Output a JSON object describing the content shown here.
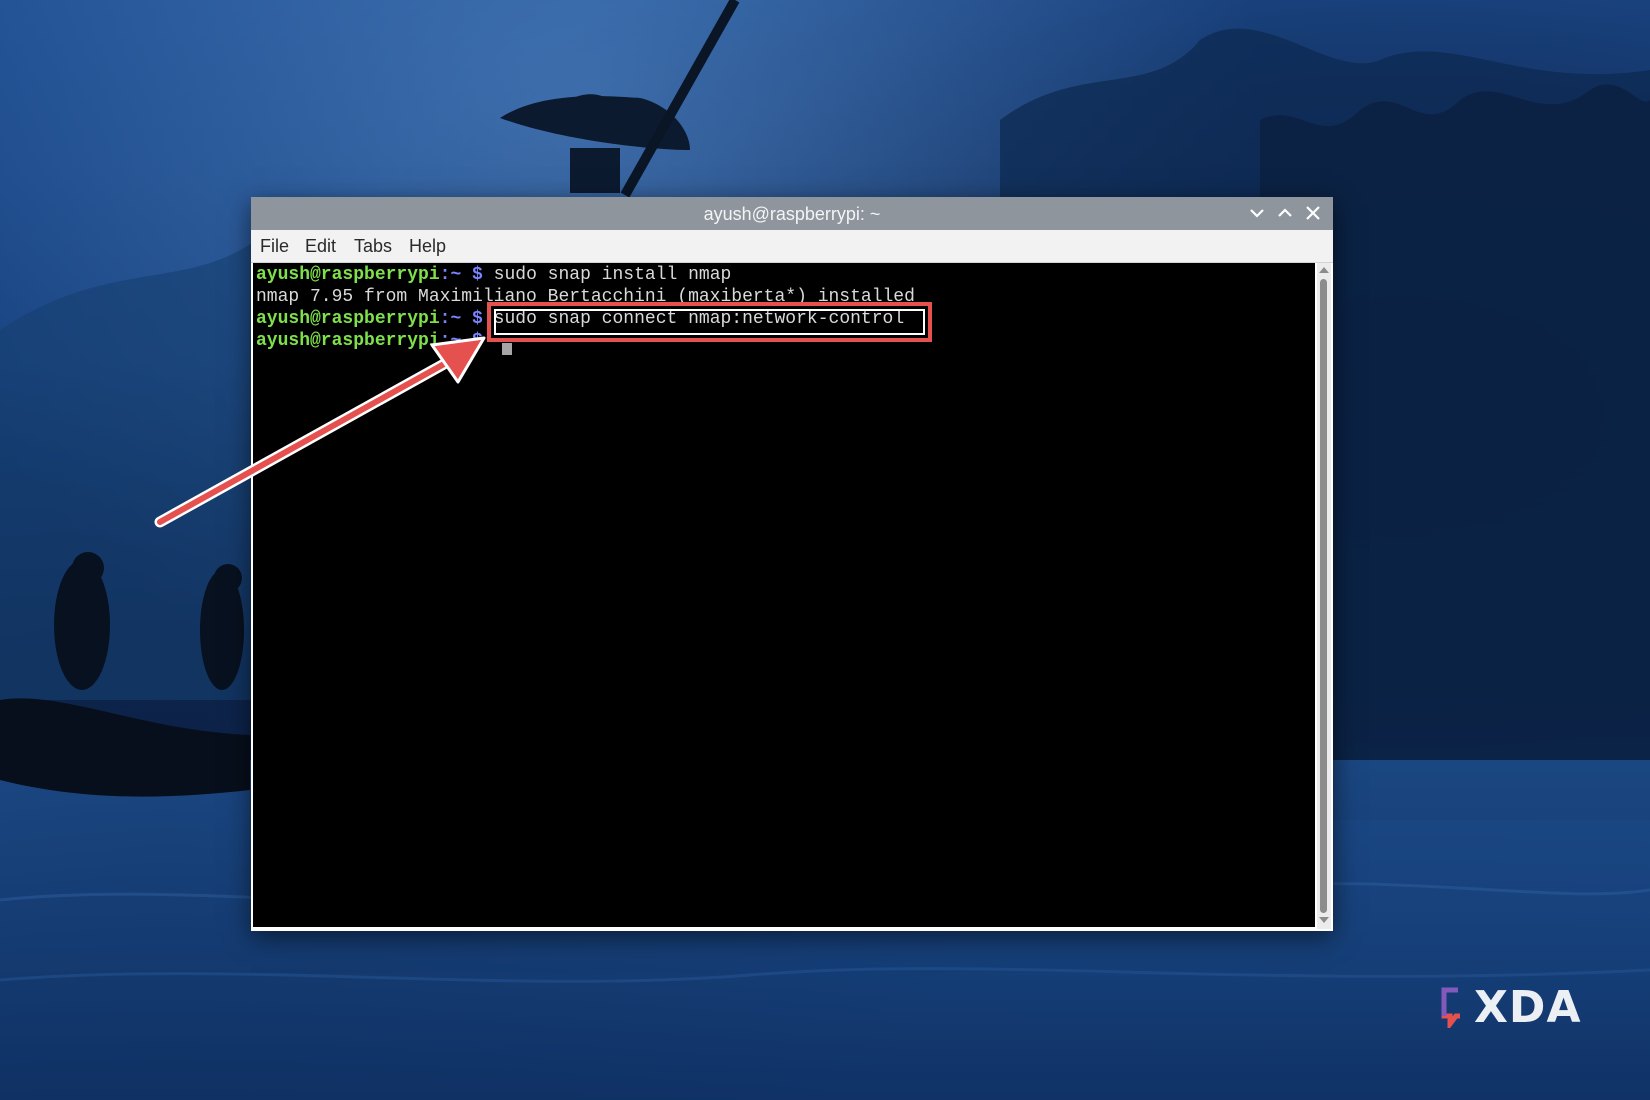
{
  "window": {
    "title": "ayush@raspberrypi: ~",
    "controls": [
      "minimize",
      "maximize",
      "close"
    ]
  },
  "menu": {
    "file": "File",
    "edit": "Edit",
    "tabs": "Tabs",
    "help": "Help"
  },
  "terminal": {
    "lines": [
      {
        "user": "ayush@raspberrypi",
        "path": ":~ $",
        "command": " sudo snap install nmap"
      },
      {
        "output": "nmap 7.95 from Maximiliano Bertacchini (maxiberta*) installed"
      },
      {
        "user": "ayush@raspberrypi",
        "path": ":~ $",
        "command": " sudo snap connect nmap:network-control"
      },
      {
        "user": "ayush@raspberrypi",
        "path": ":~ $",
        "command": " "
      }
    ]
  },
  "annotation": {
    "highlight_color": "#e5514e",
    "highlighted_command": "sudo snap connect nmap:network-control"
  },
  "watermark": {
    "brand": "XDA"
  },
  "colors": {
    "prompt_user": "#7ee04a",
    "prompt_path": "#7a86ff",
    "titlebar": "#8e959c",
    "terminal_bg": "#000000"
  }
}
